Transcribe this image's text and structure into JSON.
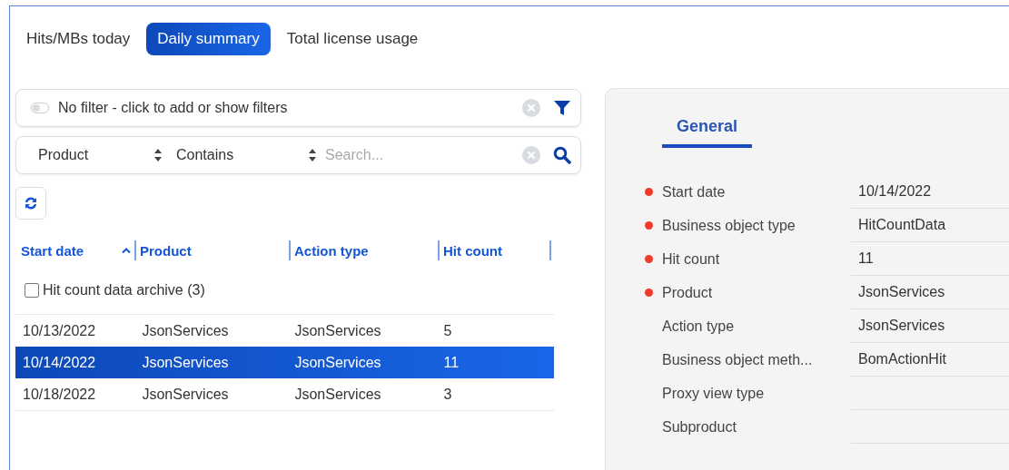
{
  "tabs": [
    {
      "label": "Hits/MBs today",
      "selected": false
    },
    {
      "label": "Daily summary",
      "selected": true
    },
    {
      "label": "Total license usage",
      "selected": false
    }
  ],
  "filter_bar": {
    "text": "No filter - click to add or show filters",
    "toggle_on": false
  },
  "search": {
    "field": "Product",
    "operator": "Contains",
    "placeholder": "Search..."
  },
  "table": {
    "columns": [
      {
        "label": "Start date",
        "sorted": true
      },
      {
        "label": "Product",
        "sorted": false
      },
      {
        "label": "Action type",
        "sorted": false
      },
      {
        "label": "Hit count",
        "sorted": false
      }
    ],
    "group": {
      "label": "Hit count data archive (3)",
      "checked": false
    },
    "rows": [
      {
        "cells": [
          "10/13/2022",
          "JsonServices",
          "JsonServices",
          "5"
        ],
        "selected": false
      },
      {
        "cells": [
          "10/14/2022",
          "JsonServices",
          "JsonServices",
          "11"
        ],
        "selected": true
      },
      {
        "cells": [
          "10/18/2022",
          "JsonServices",
          "JsonServices",
          "3"
        ],
        "selected": false
      }
    ]
  },
  "details": {
    "tabs": [
      {
        "label": "General",
        "selected": true
      }
    ],
    "fields": [
      {
        "label": "Start date",
        "value": "10/14/2022",
        "required": true
      },
      {
        "label": "Business object type",
        "value": "HitCountData",
        "required": true
      },
      {
        "label": "Hit count",
        "value": "11",
        "required": true
      },
      {
        "label": "Product",
        "value": "JsonServices",
        "required": true
      },
      {
        "label": "Action type",
        "value": "JsonServices",
        "required": false
      },
      {
        "label": "Business object meth...",
        "value": "BomActionHit",
        "required": false
      },
      {
        "label": "Proxy view type",
        "required": false
      },
      {
        "label": "Subproduct",
        "required": false
      }
    ]
  }
}
